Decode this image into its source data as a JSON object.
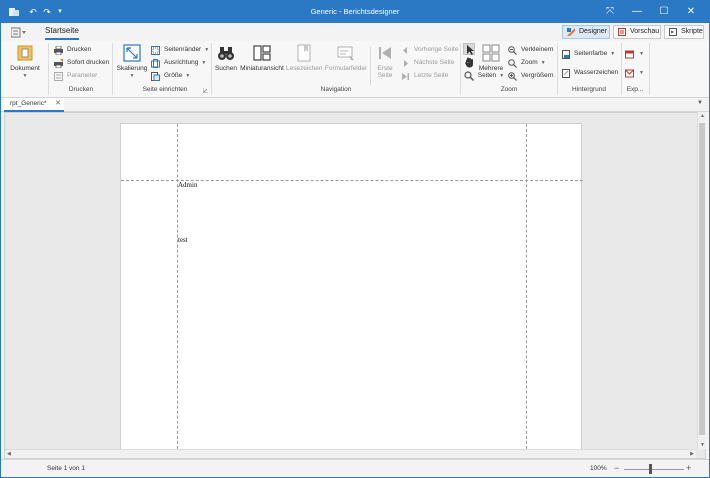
{
  "window": {
    "title": "Generic - Berichtsdesigner",
    "minimize_glyph": "—",
    "maximize_glyph": "☐",
    "close_glyph": "✕",
    "restore_glyph": "⤧"
  },
  "quick_access": {
    "undo_glyph": "↶",
    "redo_glyph": "↷",
    "customize_glyph": "▾"
  },
  "ribbon": {
    "tab_label": "Startseite",
    "view_buttons": {
      "designer": "Designer",
      "preview": "Vorschau",
      "scripts": "Skripte"
    },
    "groups": {
      "dokument": {
        "label": "",
        "button": "Dokument"
      },
      "drucken": {
        "label": "Drucken",
        "print": "Drucken",
        "quick_print": "Sofort drucken",
        "parameters": "Parameter"
      },
      "seite": {
        "label": "Seite einrichten",
        "scaling": "Skalierung",
        "margins": "Seitenränder",
        "orientation": "Ausrichtung",
        "size": "Größe"
      },
      "navigation": {
        "label": "Navigation",
        "search": "Suchen",
        "thumbnails": "Miniaturansicht",
        "bookmarks": "Lesezeichen",
        "form_fields": "Formularfelder",
        "first_page_l1": "Erste",
        "first_page_l2": "Seite",
        "prev_page": "Vorherige Seite",
        "next_page": "Nächste Seite",
        "last_page": "Letzte Seite"
      },
      "zoom": {
        "label": "Zoom",
        "multi_l1": "Mehrere",
        "multi_l2": "Seiten",
        "zoom_out": "Verkleinern",
        "zoom": "Zoom",
        "zoom_in": "Vergrößern"
      },
      "hintergrund": {
        "label": "Hintergrund",
        "page_color": "Seitenfarbe",
        "watermark": "Wasserzeichen"
      },
      "export": {
        "label": "Exp..."
      }
    }
  },
  "document_tab": {
    "label": "rpt_Generic*",
    "close_glyph": "✕"
  },
  "page": {
    "field1": "Admin",
    "field2": "test"
  },
  "status": {
    "page_info": "Seite 1 von 1",
    "zoom_level": "100%",
    "zoom_value_percent": 100
  },
  "colors": {
    "accent": "#2b78c5"
  }
}
